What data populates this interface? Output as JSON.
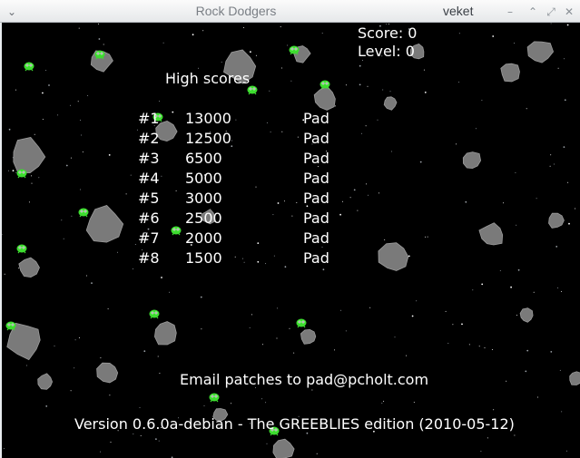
{
  "window": {
    "title": "Rock Dodgers",
    "app_name": "veket",
    "menu_icon": "chevron-down-icon",
    "buttons": [
      "minimize-icon",
      "shade-icon",
      "maximize-icon",
      "close-icon"
    ]
  },
  "hud": {
    "score": "Score: 0",
    "level": "Level: 0"
  },
  "high_scores": {
    "title": "High scores",
    "rows": [
      {
        "rank": "#1",
        "score": "13000",
        "name": "Pad"
      },
      {
        "rank": "#2",
        "score": "12500",
        "name": "Pad"
      },
      {
        "rank": "#3",
        "score": "6500",
        "name": "Pad"
      },
      {
        "rank": "#4",
        "score": "5000",
        "name": "Pad"
      },
      {
        "rank": "#5",
        "score": "3000",
        "name": "Pad"
      },
      {
        "rank": "#6",
        "score": "2500",
        "name": "Pad"
      },
      {
        "rank": "#7",
        "score": "2000",
        "name": "Pad"
      },
      {
        "rank": "#8",
        "score": "1500",
        "name": "Pad"
      }
    ]
  },
  "footer": {
    "email": "Email patches to pad@pcholt.com",
    "version": "Version 0.6.0a-debian - The GREEBLIES edition (2010-05-12)"
  },
  "colors": {
    "background": "#000000",
    "text": "#ffffff",
    "asteroid": "#7a7a7a",
    "greeblie": "#3ddc2f"
  }
}
